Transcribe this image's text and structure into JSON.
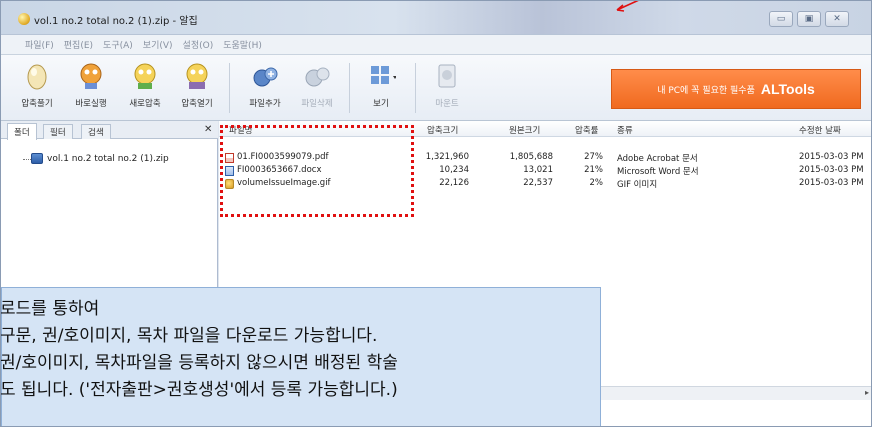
{
  "window": {
    "title": "vol.1 no.2 total no.2 (1).zip - 알집",
    "controls": [
      "minimize",
      "maximize",
      "close"
    ]
  },
  "menu": [
    "파일(F)",
    "편집(E)",
    "도구(A)",
    "보기(V)",
    "설정(O)",
    "도움말(H)"
  ],
  "toolbar": {
    "buttons": [
      {
        "label": "압축풀기",
        "icon": "egg-icon",
        "disabled": false
      },
      {
        "label": "바로실행",
        "icon": "run-character-icon",
        "disabled": false
      },
      {
        "label": "새로압축",
        "icon": "compress-character-icon",
        "disabled": false
      },
      {
        "label": "압축열기",
        "icon": "open-archive-icon",
        "disabled": false
      },
      {
        "label": "파일추가",
        "icon": "add-file-icon",
        "disabled": false
      },
      {
        "label": "파일삭제",
        "icon": "delete-file-icon",
        "disabled": true
      },
      {
        "label": "보기",
        "icon": "view-grid-icon",
        "disabled": false
      },
      {
        "label": "마운트",
        "icon": "mount-disc-icon",
        "disabled": true
      }
    ],
    "ad": {
      "text": "내 PC에 꼭 필요한 필수품",
      "brand": "ALTools"
    }
  },
  "left_panel": {
    "tabs": [
      "폴더",
      "필터",
      "검색"
    ],
    "tree_item": "vol.1 no.2 total no.2 (1).zip"
  },
  "file_list": {
    "columns": [
      "파일명",
      "압축크기",
      "원본크기",
      "압축률",
      "종류",
      "수정한 날짜"
    ],
    "rows": [
      {
        "name": "01.FI0003599079.pdf",
        "packed": "1,321,960",
        "original": "1,805,688",
        "ratio": "27%",
        "type": "Adobe Acrobat 문서",
        "date": "2015-03-03 PM",
        "icon": "pdf"
      },
      {
        "name": "FI0003653667.docx",
        "packed": "10,234",
        "original": "13,021",
        "ratio": "21%",
        "type": "Microsoft Word 문서",
        "date": "2015-03-03 PM",
        "icon": "doc"
      },
      {
        "name": "volumeIssueImage.gif",
        "packed": "22,126",
        "original": "22,537",
        "ratio": "2%",
        "type": "GIF 이미지",
        "date": "2015-03-03 PM",
        "icon": "gif"
      }
    ]
  },
  "note": {
    "lines": [
      "로드를 통하여",
      "구문, 권/호이미지, 목차 파일을 다운로드 가능합니다.",
      "권/호이미지, 목차파일을 등록하지 않으시면 배정된 학술",
      "도 됩니다. ('전자출판>권호생성'에서 등록 가능합니다.)"
    ]
  },
  "colors": {
    "highlight": "#e01010",
    "note_bg": "#d5e4f5",
    "ad_bg": "#f06a1f"
  }
}
